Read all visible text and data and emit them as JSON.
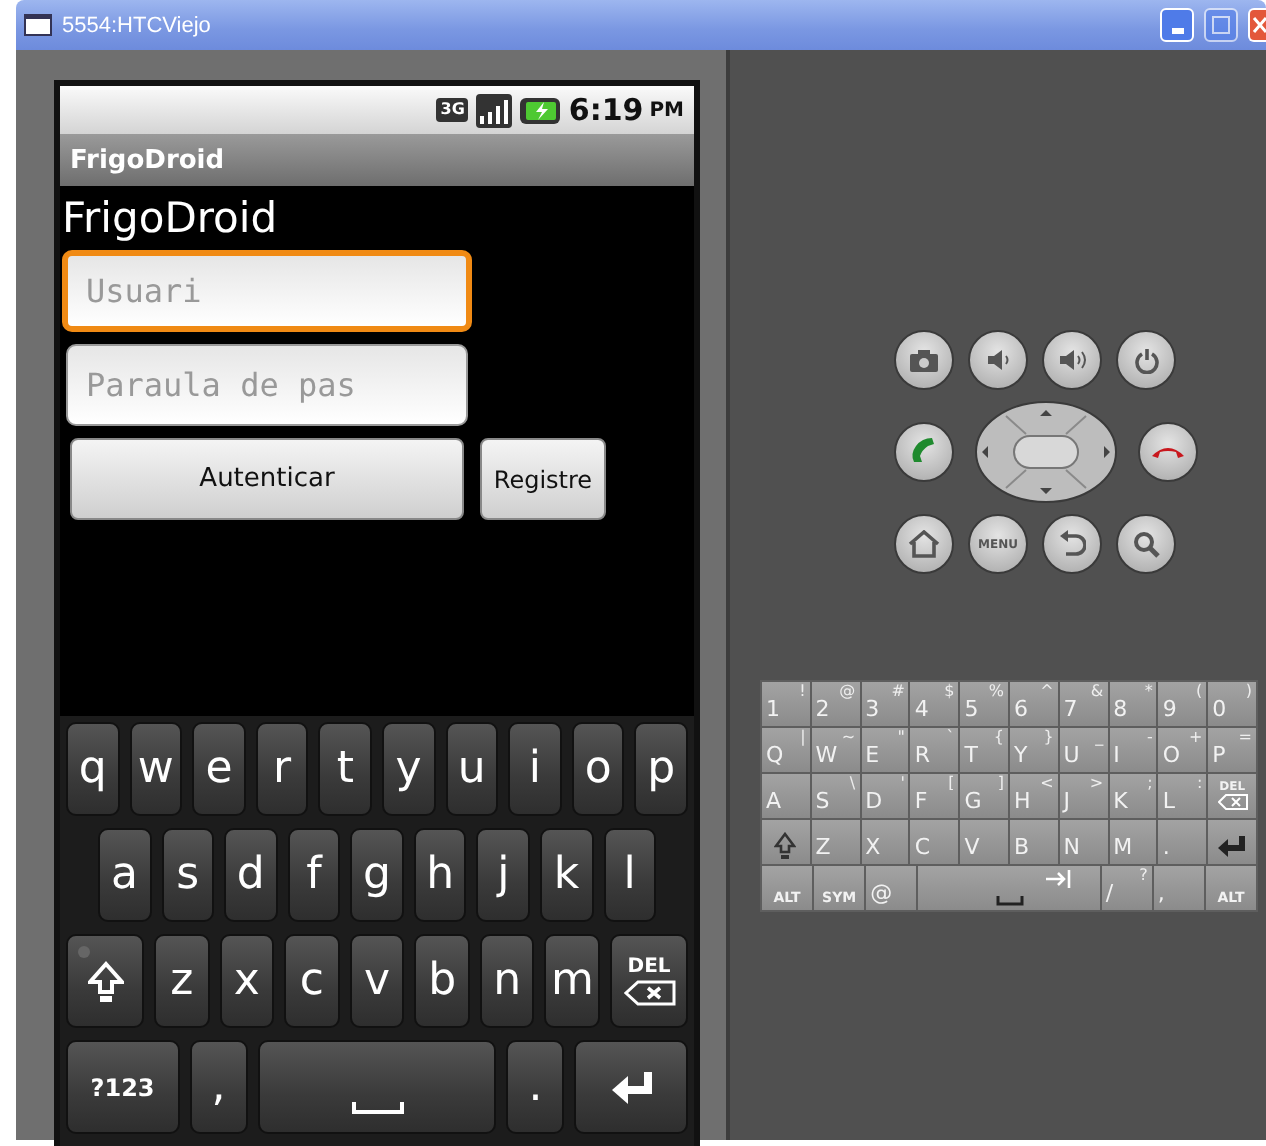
{
  "window": {
    "title": "5554:HTCViejo"
  },
  "status_bar": {
    "network": "3G",
    "time": "6:19",
    "period": "PM"
  },
  "app": {
    "title_bar": "FrigoDroid",
    "heading": "FrigoDroid",
    "fields": [
      {
        "placeholder": "Usuari",
        "focused": true
      },
      {
        "placeholder": "Paraula de pas",
        "focused": false
      }
    ],
    "buttons": [
      {
        "label": "Autenticar",
        "kind": "wide"
      },
      {
        "label": "Registre",
        "kind": "compact"
      }
    ]
  },
  "soft_keyboard": {
    "rows": [
      [
        {
          "kind": "char",
          "label": "q"
        },
        {
          "kind": "char",
          "label": "w"
        },
        {
          "kind": "char",
          "label": "e"
        },
        {
          "kind": "char",
          "label": "r"
        },
        {
          "kind": "char",
          "label": "t"
        },
        {
          "kind": "char",
          "label": "y"
        },
        {
          "kind": "char",
          "label": "u"
        },
        {
          "kind": "char",
          "label": "i"
        },
        {
          "kind": "char",
          "label": "o"
        },
        {
          "kind": "char",
          "label": "p"
        }
      ],
      [
        {
          "kind": "char",
          "label": "a"
        },
        {
          "kind": "char",
          "label": "s"
        },
        {
          "kind": "char",
          "label": "d"
        },
        {
          "kind": "char",
          "label": "f"
        },
        {
          "kind": "char",
          "label": "g"
        },
        {
          "kind": "char",
          "label": "h"
        },
        {
          "kind": "char",
          "label": "j"
        },
        {
          "kind": "char",
          "label": "k"
        },
        {
          "kind": "char",
          "label": "l"
        }
      ],
      [
        {
          "kind": "shift"
        },
        {
          "kind": "char",
          "label": "z"
        },
        {
          "kind": "char",
          "label": "x"
        },
        {
          "kind": "char",
          "label": "c"
        },
        {
          "kind": "char",
          "label": "v"
        },
        {
          "kind": "char",
          "label": "b"
        },
        {
          "kind": "char",
          "label": "n"
        },
        {
          "kind": "char",
          "label": "m"
        },
        {
          "kind": "del",
          "label": "DEL"
        }
      ],
      [
        {
          "kind": "mode",
          "label": "?123"
        },
        {
          "kind": "char",
          "label": ","
        },
        {
          "kind": "space"
        },
        {
          "kind": "char",
          "label": "."
        },
        {
          "kind": "enter"
        }
      ]
    ]
  },
  "hardware_buttons": [
    [
      {
        "kind": "camera"
      },
      {
        "kind": "volume_down"
      },
      {
        "kind": "volume_up"
      },
      {
        "kind": "power"
      }
    ],
    [
      {
        "kind": "call"
      },
      {
        "kind": "dpad"
      },
      {
        "kind": "end_call"
      }
    ],
    [
      {
        "kind": "home"
      },
      {
        "kind": "menu",
        "label": "MENU"
      },
      {
        "kind": "back"
      },
      {
        "kind": "search"
      }
    ]
  ],
  "hardware_keyboard": {
    "rows": [
      [
        {
          "kind": "char",
          "label": "1",
          "alt": "!"
        },
        {
          "kind": "char",
          "label": "2",
          "alt": "@"
        },
        {
          "kind": "char",
          "label": "3",
          "alt": "#"
        },
        {
          "kind": "char",
          "label": "4",
          "alt": "$"
        },
        {
          "kind": "char",
          "label": "5",
          "alt": "%"
        },
        {
          "kind": "char",
          "label": "6",
          "alt": "^"
        },
        {
          "kind": "char",
          "label": "7",
          "alt": "&"
        },
        {
          "kind": "char",
          "label": "8",
          "alt": "*"
        },
        {
          "kind": "char",
          "label": "9",
          "alt": "("
        },
        {
          "kind": "char",
          "label": "0",
          "alt": ")"
        }
      ],
      [
        {
          "kind": "char",
          "label": "Q",
          "alt": "|"
        },
        {
          "kind": "char",
          "label": "W",
          "alt": "~"
        },
        {
          "kind": "char",
          "label": "E",
          "alt": "\""
        },
        {
          "kind": "char",
          "label": "R",
          "alt": "`"
        },
        {
          "kind": "char",
          "label": "T",
          "alt": "{"
        },
        {
          "kind": "char",
          "label": "Y",
          "alt": "}"
        },
        {
          "kind": "char",
          "label": "U",
          "alt": "_"
        },
        {
          "kind": "char",
          "label": "I",
          "alt": "-"
        },
        {
          "kind": "char",
          "label": "O",
          "alt": "+"
        },
        {
          "kind": "char",
          "label": "P",
          "alt": "="
        }
      ],
      [
        {
          "kind": "char",
          "label": "A"
        },
        {
          "kind": "char",
          "label": "S",
          "alt": "\\"
        },
        {
          "kind": "char",
          "label": "D",
          "alt": "'"
        },
        {
          "kind": "char",
          "label": "F",
          "alt": "["
        },
        {
          "kind": "char",
          "label": "G",
          "alt": "]"
        },
        {
          "kind": "char",
          "label": "H",
          "alt": "<"
        },
        {
          "kind": "char",
          "label": "J",
          "alt": ">"
        },
        {
          "kind": "char",
          "label": "K",
          "alt": ";"
        },
        {
          "kind": "char",
          "label": "L",
          "alt": ":"
        },
        {
          "kind": "del",
          "label": "DEL"
        }
      ],
      [
        {
          "kind": "shift"
        },
        {
          "kind": "char",
          "label": "Z"
        },
        {
          "kind": "char",
          "label": "X"
        },
        {
          "kind": "char",
          "label": "C"
        },
        {
          "kind": "char",
          "label": "V"
        },
        {
          "kind": "char",
          "label": "B"
        },
        {
          "kind": "char",
          "label": "N"
        },
        {
          "kind": "char",
          "label": "M"
        },
        {
          "kind": "char",
          "label": "."
        },
        {
          "kind": "enter"
        }
      ]
    ],
    "bottom_row": {
      "left": [
        {
          "kind": "mod",
          "label": "ALT"
        },
        {
          "kind": "mod",
          "label": "SYM"
        },
        {
          "kind": "char",
          "label": "@"
        }
      ],
      "right": [
        {
          "kind": "char",
          "label": "/",
          "alt": "?"
        },
        {
          "kind": "char",
          "label": ","
        },
        {
          "kind": "mod",
          "label": "ALT"
        }
      ]
    }
  }
}
